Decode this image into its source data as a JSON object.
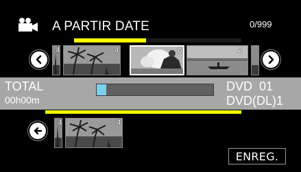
{
  "header": {
    "mode_icon": "video-camera-icon",
    "title": "A PARTIR DATE",
    "counter": "0/999"
  },
  "top_progress": {
    "fraction": 0.43
  },
  "nav": {
    "prev_icon": "circle-chevron-left-icon",
    "next_icon": "circle-chevron-right-icon",
    "back_icon": "circle-arrow-left-icon"
  },
  "thumbnails": {
    "top": [
      {
        "number": "4",
        "scene": "palm-trees"
      },
      {
        "number": "4",
        "scene": "palm-trees"
      },
      {
        "number": "6",
        "scene": "person-with-flowers",
        "selected": true
      },
      {
        "number": "2",
        "scene": "lake-boat"
      },
      {
        "number": "",
        "scene": "partial"
      }
    ],
    "bottom": [
      {
        "number": "4",
        "scene": "palm-trees"
      },
      {
        "number": "4",
        "scene": "palm-trees"
      }
    ]
  },
  "summary": {
    "total_label": "TOTAL",
    "total_time": "00h00m",
    "capacity_fraction": 0.06,
    "disc_line1": "DVD  01",
    "disc_line2": "DVD(DL)1"
  },
  "actions": {
    "record_label": "ENREG."
  },
  "colors": {
    "accent_yellow": "#ffff00",
    "band_gray": "#a7a7a7",
    "capacity_fill": "#7ad0ef"
  }
}
